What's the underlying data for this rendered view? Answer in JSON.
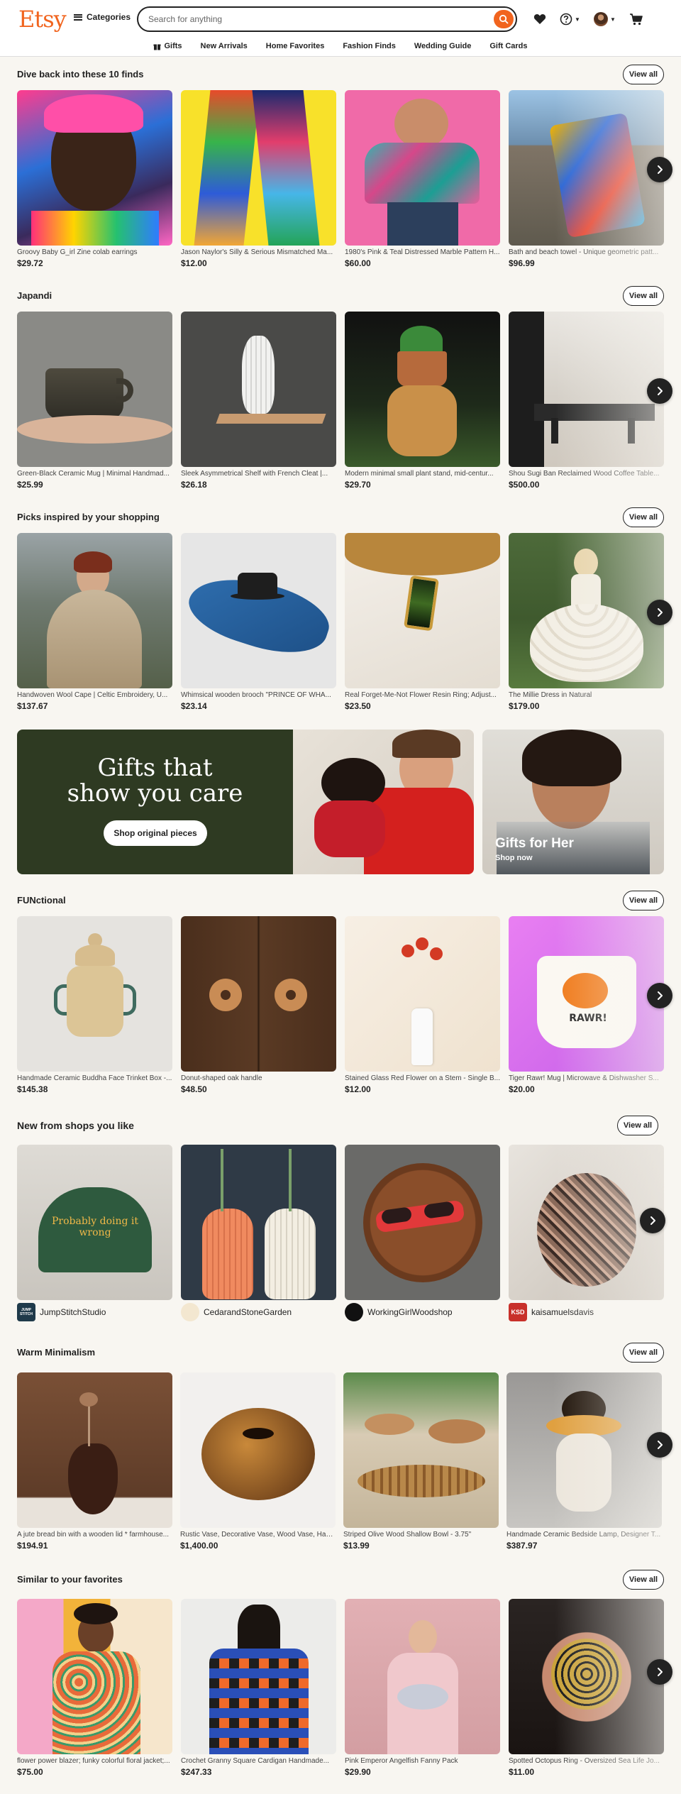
{
  "header": {
    "logo": "Etsy",
    "categories": "Categories",
    "search_placeholder": "Search for anything",
    "nav": [
      "Gifts",
      "New Arrivals",
      "Home Favorites",
      "Fashion Finds",
      "Wedding Guide",
      "Gift Cards"
    ]
  },
  "colors": {
    "brand": "#f1641e",
    "banner_green": "#2e3a22",
    "background": "#f8f6f1"
  },
  "icons": [
    "hamburger-icon",
    "search-icon",
    "heart-icon",
    "help-icon",
    "cart-icon",
    "gift-icon",
    "chevron-right-icon"
  ],
  "sections": [
    {
      "title": "Dive back into these 10 finds",
      "view_all": "View all",
      "items": [
        {
          "title": "Groovy Baby G_irl Zine colab earrings",
          "price": "$29.72"
        },
        {
          "title": "Jason Naylor's Silly & Serious Mismatched Ma...",
          "price": "$12.00"
        },
        {
          "title": "1980's Pink & Teal Distressed Marble Pattern H...",
          "price": "$60.00"
        },
        {
          "title": "Bath and beach towel - Unique geometric patt...",
          "price": "$96.99"
        }
      ]
    },
    {
      "title": "Japandi",
      "view_all": "View all",
      "items": [
        {
          "title": "Green-Black Ceramic Mug | Minimal Handmad...",
          "price": "$25.99"
        },
        {
          "title": "Sleek Asymmetrical Shelf with French Cleat |...",
          "price": "$26.18"
        },
        {
          "title": "Modern minimal small plant stand, mid-centur...",
          "price": "$29.70"
        },
        {
          "title": "Shou Sugi Ban Reclaimed Wood Coffee Table...",
          "price": "$500.00"
        }
      ]
    },
    {
      "title": "Picks inspired by your shopping",
      "view_all": "View all",
      "items": [
        {
          "title": "Handwoven Wool Cape | Celtic Embroidery, U...",
          "price": "$137.67"
        },
        {
          "title": "Whimsical wooden brooch \"PRINCE OF WHA...",
          "price": "$23.14"
        },
        {
          "title": "Real Forget-Me-Not Flower Resin Ring; Adjust...",
          "price": "$23.50"
        },
        {
          "title": "The Millie Dress in Natural",
          "price": "$179.00"
        }
      ]
    },
    {
      "title": "FUNctional",
      "view_all": "View all",
      "items": [
        {
          "title": "Handmade Ceramic Buddha Face Trinket Box -...",
          "price": "$145.38"
        },
        {
          "title": "Donut-shaped oak handle",
          "price": "$48.50"
        },
        {
          "title": "Stained Glass Red Flower on a Stem - Single B...",
          "price": "$12.00"
        },
        {
          "title": "Tiger Rawr! Mug | Microwave & Dishwasher S...",
          "price": "$20.00"
        }
      ]
    },
    {
      "title": "New from shops you like",
      "view_all": "View all",
      "shops": [
        "JumpStitchStudio",
        "CedarandStoneGarden",
        "WorkingGirlWoodshop",
        "kaisamuelsdavis"
      ],
      "hat_text": "Probably doing it wrong",
      "shop_badges": [
        "JUMP STITCH",
        "KSD"
      ]
    },
    {
      "title": "Warm Minimalism",
      "view_all": "View all",
      "items": [
        {
          "title": "A jute bread bin with a wooden lid * farmhouse...",
          "price": "$194.91"
        },
        {
          "title": "Rustic Vase, Decorative Vase, Wood Vase, Han...",
          "price": "$1,400.00"
        },
        {
          "title": "Striped Olive Wood Shallow Bowl - 3.75\"",
          "price": "$13.99"
        },
        {
          "title": "Handmade Ceramic Bedside Lamp, Designer T...",
          "price": "$387.97"
        }
      ]
    },
    {
      "title": "Similar to your favorites",
      "view_all": "View all",
      "items": [
        {
          "title": "flower power blazer; funky colorful floral jacket;...",
          "price": "$75.00"
        },
        {
          "title": "Crochet Granny Square Cardigan Handmade...",
          "price": "$247.33"
        },
        {
          "title": "Pink Emperor Angelfish Fanny Pack",
          "price": "$29.90"
        },
        {
          "title": "Spotted Octopus Ring - Oversized Sea Life Jo...",
          "price": "$11.00"
        }
      ]
    }
  ],
  "banner": {
    "headline_line1": "Gifts that",
    "headline_line2": "show you care",
    "button": "Shop original pieces"
  },
  "gifts_for_her": {
    "title": "Gifts for Her",
    "cta": "Shop now"
  },
  "mug_text": "RAWR!"
}
